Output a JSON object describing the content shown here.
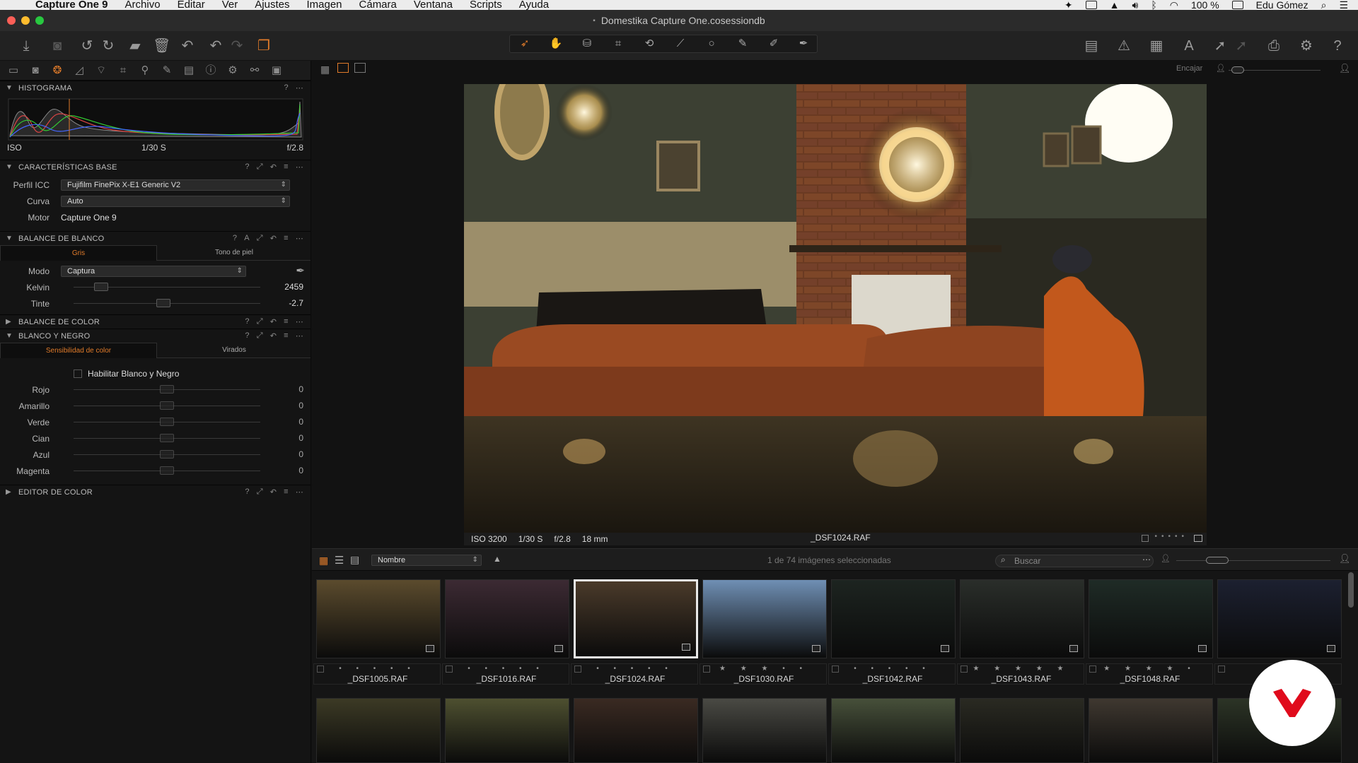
{
  "menubar": {
    "apple": "",
    "items": [
      "Capture One 9",
      "Archivo",
      "Editar",
      "Ver",
      "Ajustes",
      "Imagen",
      "Cámara",
      "Ventana",
      "Scripts",
      "Ayuda"
    ],
    "battery": "100 %",
    "user": "Edu Gómez"
  },
  "window": {
    "title": "Domestika Capture One.cosessiondb"
  },
  "viewer": {
    "fit_label": "Encajar",
    "photo_meta": {
      "iso": "ISO 3200",
      "shutter": "1/30 S",
      "aperture": "f/2.8",
      "focal": "18 mm"
    },
    "filename": "_DSF1024.RAF"
  },
  "histogram": {
    "title": "HISTOGRAMA",
    "iso": "ISO",
    "shutter": "1/30 S",
    "aperture": "f/2.8"
  },
  "base": {
    "title": "CARACTERÍSTICAS BASE",
    "icc_label": "Perfil ICC",
    "icc_value": "Fujifilm FinePix X-E1 Generic V2",
    "curve_label": "Curva",
    "curve_value": "Auto",
    "engine_label": "Motor",
    "engine_value": "Capture One 9"
  },
  "wb": {
    "title": "BALANCE DE BLANCO",
    "tab1": "Gris",
    "tab2": "Tono de piel",
    "mode_label": "Modo",
    "mode_value": "Captura",
    "kelvin_label": "Kelvin",
    "kelvin_value": "2459",
    "kelvin_level": 0.12,
    "tint_label": "Tinte",
    "tint_value": "-2.7",
    "tint_level": 0.48
  },
  "color_balance": {
    "title": "BALANCE DE COLOR"
  },
  "bw": {
    "title": "BLANCO Y NEGRO",
    "tab1": "Sensibilidad de color",
    "tab2": "Virados",
    "enable_label": "Habilitar Blanco y Negro",
    "sliders": [
      {
        "label": "Rojo",
        "value": "0"
      },
      {
        "label": "Amarillo",
        "value": "0"
      },
      {
        "label": "Verde",
        "value": "0"
      },
      {
        "label": "Cian",
        "value": "0"
      },
      {
        "label": "Azul",
        "value": "0"
      },
      {
        "label": "Magenta",
        "value": "0"
      }
    ]
  },
  "color_editor": {
    "title": "EDITOR DE COLOR"
  },
  "browser": {
    "sort_value": "Nombre",
    "selection_text": "1 de 74 imágenes seleccionadas",
    "search_placeholder": "Buscar",
    "thumbs": [
      {
        "name": "_DSF1005.RAF",
        "stars": "• • • • •",
        "color": "#5b4b2d"
      },
      {
        "name": "_DSF1016.RAF",
        "stars": "• • • • •",
        "color": "#3c2a33"
      },
      {
        "name": "_DSF1024.RAF",
        "stars": "• • • • •",
        "color": "#4a3a2a",
        "selected": true
      },
      {
        "name": "_DSF1030.RAF",
        "stars": "★ ★ ★ • •",
        "color": "#6f8fb4"
      },
      {
        "name": "_DSF1042.RAF",
        "stars": "• • • • •",
        "color": "#1d2420"
      },
      {
        "name": "_DSF1043.RAF",
        "stars": "★ ★ ★ ★ ★",
        "color": "#2a2e2a"
      },
      {
        "name": "_DSF1048.RAF",
        "stars": "★ ★ ★ ★ •",
        "color": "#1f2b26"
      },
      {
        "name": "_D",
        "stars": "★",
        "color": "#1c2030"
      }
    ],
    "thumbs_row2": [
      "#3c3a25",
      "#4e5030",
      "#3a2a22",
      "#4a4a44",
      "#47503a",
      "#2a2a22",
      "#3f3830",
      "#2c3426"
    ]
  },
  "colors": {
    "accent": "#e07b2a",
    "brand_logo": "#e00b1c"
  }
}
